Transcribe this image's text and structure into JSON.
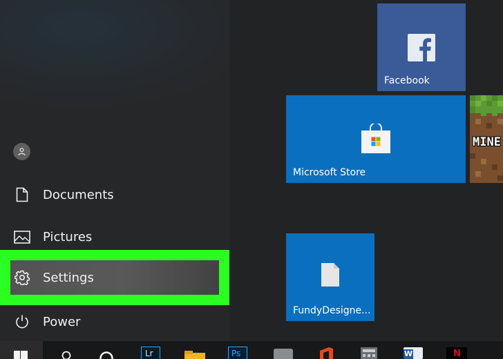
{
  "start_menu": {
    "items": [
      {
        "label": "Documents",
        "icon": "document-icon"
      },
      {
        "label": "Pictures",
        "icon": "pictures-icon"
      },
      {
        "label": "Settings",
        "icon": "gear-icon"
      },
      {
        "label": "Power",
        "icon": "power-icon"
      }
    ],
    "user_icon": "user-icon"
  },
  "tiles": {
    "facebook": {
      "label": "Facebook",
      "color": "#3a5a98"
    },
    "store": {
      "label": "Microsoft Store",
      "color": "#0a6fbf"
    },
    "minecraft": {
      "label": "MINE"
    },
    "fundy": {
      "label": "FundyDesigne...",
      "color": "#0a6fbf"
    }
  },
  "highlight_color": "#2bff22",
  "taskbar": {
    "icons": [
      "windows-start-icon",
      "search-icon",
      "cortana-icon",
      "lightroom-icon",
      "file-explorer-icon",
      "photoshop-icon",
      "generic-app-icon",
      "office-icon",
      "calculator-icon",
      "word-icon",
      "netflix-icon"
    ],
    "lightroom_text": "Lr",
    "photoshop_text": "Ps",
    "word_text": "W",
    "netflix_text": "N"
  }
}
